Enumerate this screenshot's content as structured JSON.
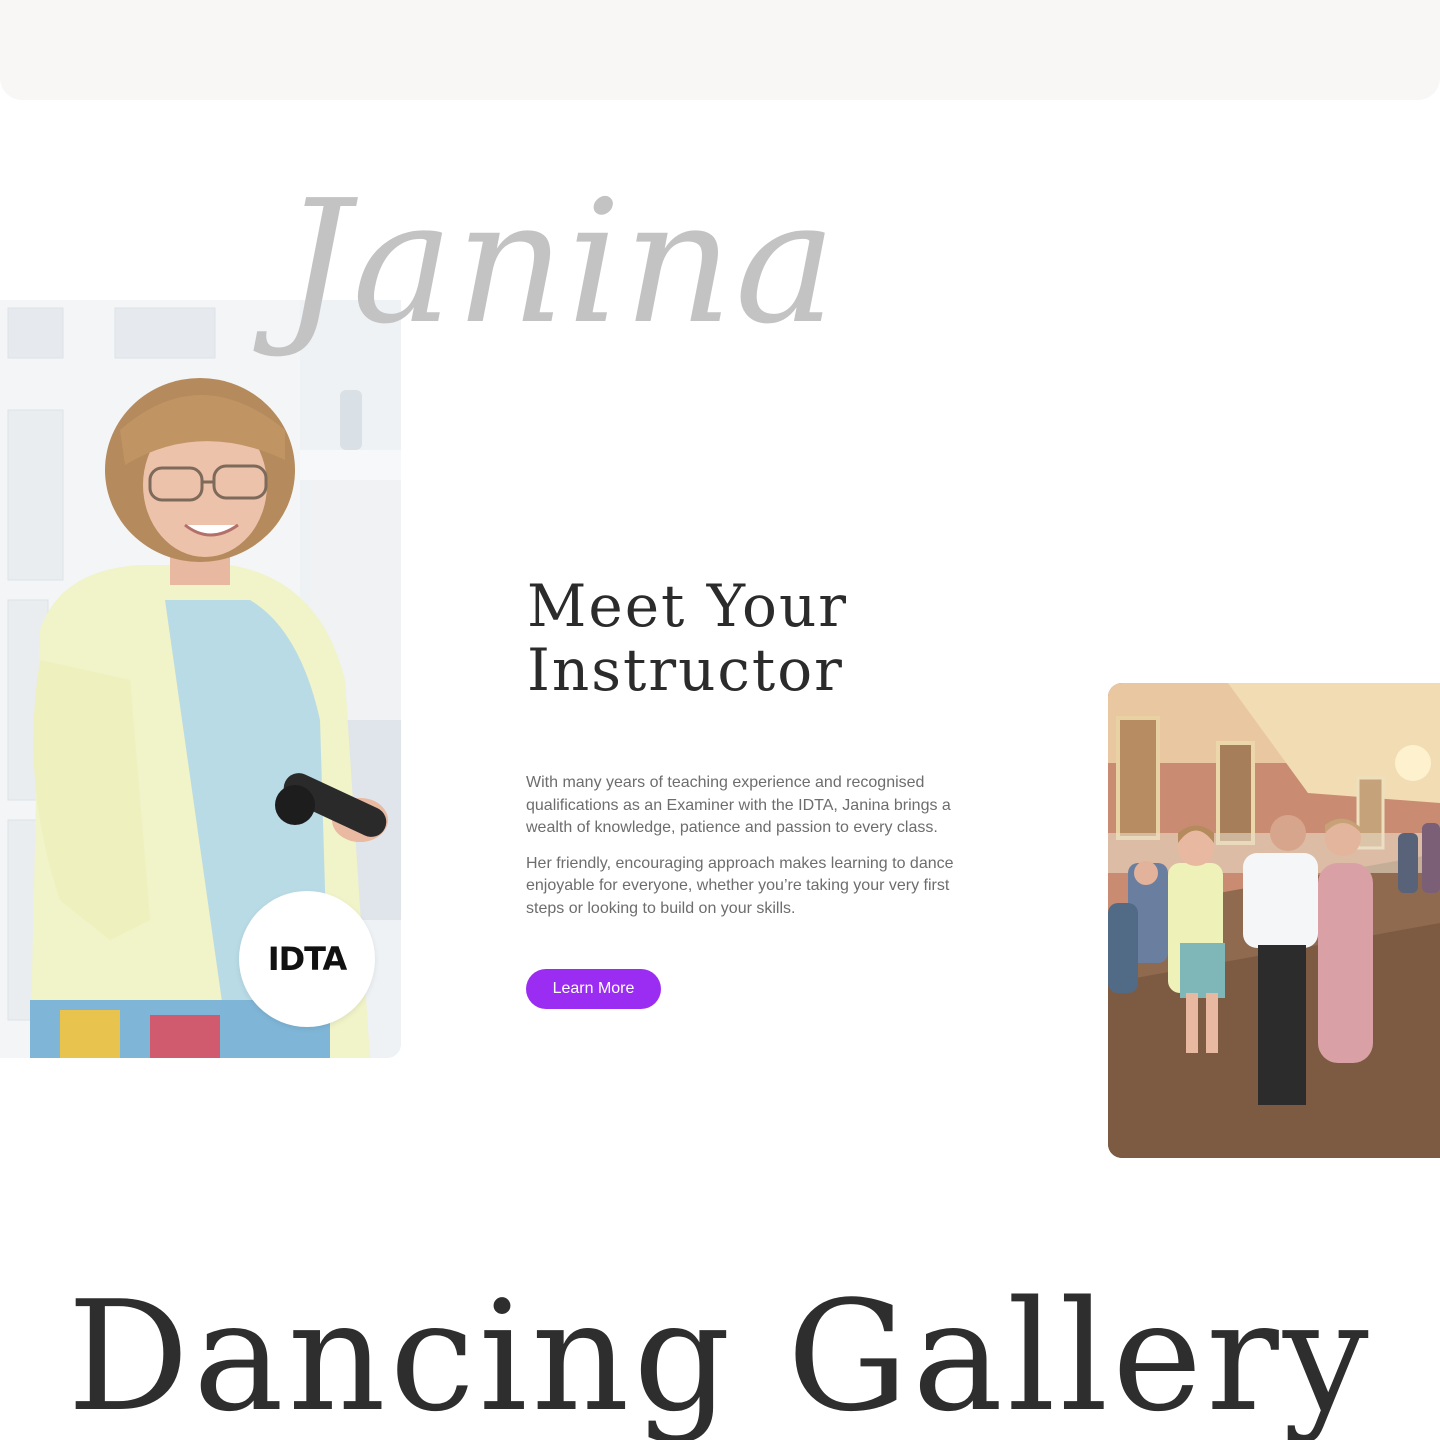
{
  "instructor": {
    "script_name": "Janina",
    "heading_line1": "Meet Your",
    "heading_line2": "Instructor",
    "paragraph1": "With many years of teaching experience and recognised qualifications as an Examiner with the IDTA, Janina brings a wealth of knowledge, patience and passion to every class.",
    "paragraph2": "Her friendly, encouraging approach makes learning to dance enjoyable for everyone, whether you’re taking your very first steps or looking to build on your skills.",
    "button_label": "Learn More",
    "badge_text": "IDTA"
  },
  "gallery": {
    "title": "Dancing Gallery"
  },
  "colors": {
    "accent": "#9b2cf2",
    "heading": "#2b2b2b",
    "body_text": "#6d6d6d",
    "script": "#c3c3c3",
    "top_band": "#f8f7f6"
  }
}
